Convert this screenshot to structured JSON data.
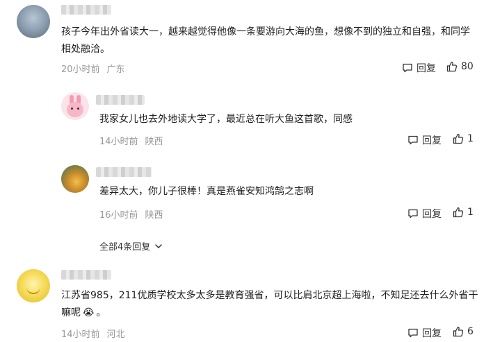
{
  "comments": [
    {
      "text": "孩子今年出外省读大一，越来越觉得他像一条要游向大海的鱼，想像不到的独立和自强，和同学相处融洽。",
      "time": "20小时前",
      "location": "广东",
      "reply_label": "回复",
      "likes": "80"
    },
    {
      "text": "我家女儿也去外地读大学了，最近总在听大鱼这首歌，同感",
      "time": "14小时前",
      "location": "陕西",
      "reply_label": "回复",
      "likes": "1"
    },
    {
      "text": "差异太大，你儿子很棒！真是燕雀安知鸿鹄之志啊",
      "time": "16小时前",
      "location": "陕西",
      "reply_label": "回复",
      "likes": "1"
    },
    {
      "text": "江苏省985，211优质学校太多太多是教育强省，可以比肩北京超上海啦，不知足还去什么外省干嘛呢",
      "time": "14小时前",
      "location": "河北",
      "reply_label": "回复",
      "likes": "6"
    }
  ],
  "expand_replies_label": "全部4条回复",
  "emoji": "😭",
  "trailing_period": "。",
  "icons": {
    "reply": "comment-bubble-icon",
    "like": "thumbs-up-icon",
    "expand": "chevron-down-icon"
  }
}
